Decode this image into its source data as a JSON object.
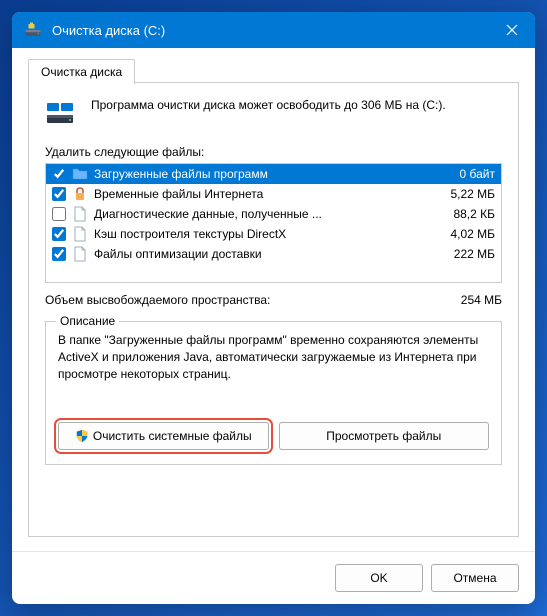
{
  "titlebar": {
    "title": "Очистка диска  (C:)"
  },
  "tab": {
    "label": "Очистка диска"
  },
  "info": {
    "text": "Программа очистки диска может освободить до 306 МБ на (C:)."
  },
  "list": {
    "label": "Удалить следующие файлы:",
    "items": [
      {
        "name": "Загруженные файлы программ",
        "size": "0 байт",
        "checked": true,
        "selected": true,
        "icon": "folder"
      },
      {
        "name": "Временные файлы Интернета",
        "size": "5,22 МБ",
        "checked": true,
        "selected": false,
        "icon": "lock"
      },
      {
        "name": "Диагностические данные, полученные ...",
        "size": "88,2 КБ",
        "checked": false,
        "selected": false,
        "icon": "file"
      },
      {
        "name": "Кэш построителя текстуры DirectX",
        "size": "4,02 МБ",
        "checked": true,
        "selected": false,
        "icon": "file"
      },
      {
        "name": "Файлы оптимизации доставки",
        "size": "222 МБ",
        "checked": true,
        "selected": false,
        "icon": "file"
      }
    ]
  },
  "summary": {
    "label": "Объем высвобождаемого пространства:",
    "value": "254 МБ"
  },
  "description": {
    "legend": "Описание",
    "text": "В папке \"Загруженные файлы программ\" временно сохраняются элементы ActiveX и приложения Java, автоматически загружаемые из Интернета при просмотре некоторых страниц."
  },
  "buttons": {
    "clean_system": "Очистить системные файлы",
    "view_files": "Просмотреть файлы",
    "ok": "OK",
    "cancel": "Отмена"
  }
}
